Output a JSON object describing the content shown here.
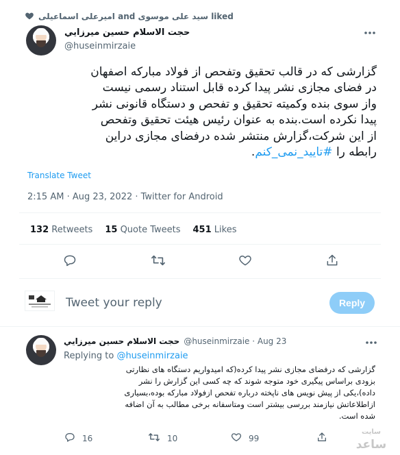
{
  "liked_line": {
    "text": "امیرعلی اسماعیلی and سید علی موسوی liked"
  },
  "tweet": {
    "display_name": "حجت الاسلام حسين ميرزايي",
    "handle": "@huseinmirzaie",
    "body_lines": [
      "گزارشی که در قالب تحقیق وتفحص از فولاد مبارکه اصفهان",
      "در فضای مجازی نشر پیدا کرده قابل استناد رسمی نیست",
      "واز سوی بنده وکمیته تحقیق و تفحص و دستگاه قانونی نشر",
      "پیدا نکرده است.بنده به عنوان رئیس هیئت تحقیق وتفحص",
      "از این شرکت،گزارش منتشر شده درفضای مجازی دراین"
    ],
    "last_line_prefix": "رابطه را",
    "hashtag": "#تایید_نمی_کنم",
    "last_line_suffix": ".",
    "translate": "Translate Tweet",
    "meta": "2:15 AM · Aug 23, 2022 · Twitter for Android",
    "stats": {
      "retweets_count": "132",
      "retweets_label": "Retweets",
      "quotes_count": "15",
      "quotes_label": "Quote Tweets",
      "likes_count": "451",
      "likes_label": "Likes"
    }
  },
  "compose": {
    "placeholder": "Tweet your reply",
    "button": "Reply"
  },
  "reply": {
    "display_name": "حجت الاسلام حسين ميرزايي",
    "handle_date": "@huseinmirzaie · Aug 23",
    "replying_label": "Replying to",
    "replying_handle": "@huseinmirzaie",
    "body_lines": [
      "گزارشی که درفضای مجازی نشر پیدا کرده(که امیدواریم دستگاه های نظارتی",
      "بزودی براساس پیگیری خود متوجه شوند که چه کسی این گزارش را نشر",
      "داده)،یکی از پیش نویس های ناپخته درباره تفحص ازفولاد مبارکه بوده،بسیاری",
      "ازاطلاعاتش نیازمند بررسی بیشتر است ومتاسفانه برخی مطالب به آن اضافه",
      "شده است."
    ],
    "reply_count": "16",
    "retweet_count": "10",
    "like_count": "99"
  },
  "watermark": {
    "top": "سایت",
    "bottom": "ساعد"
  },
  "colors": {
    "accent": "#1d9bf0",
    "text": "#0f1419",
    "muted": "#536471",
    "divider": "#eff3f4",
    "reply_button_disabled": "#8ecdf8"
  }
}
